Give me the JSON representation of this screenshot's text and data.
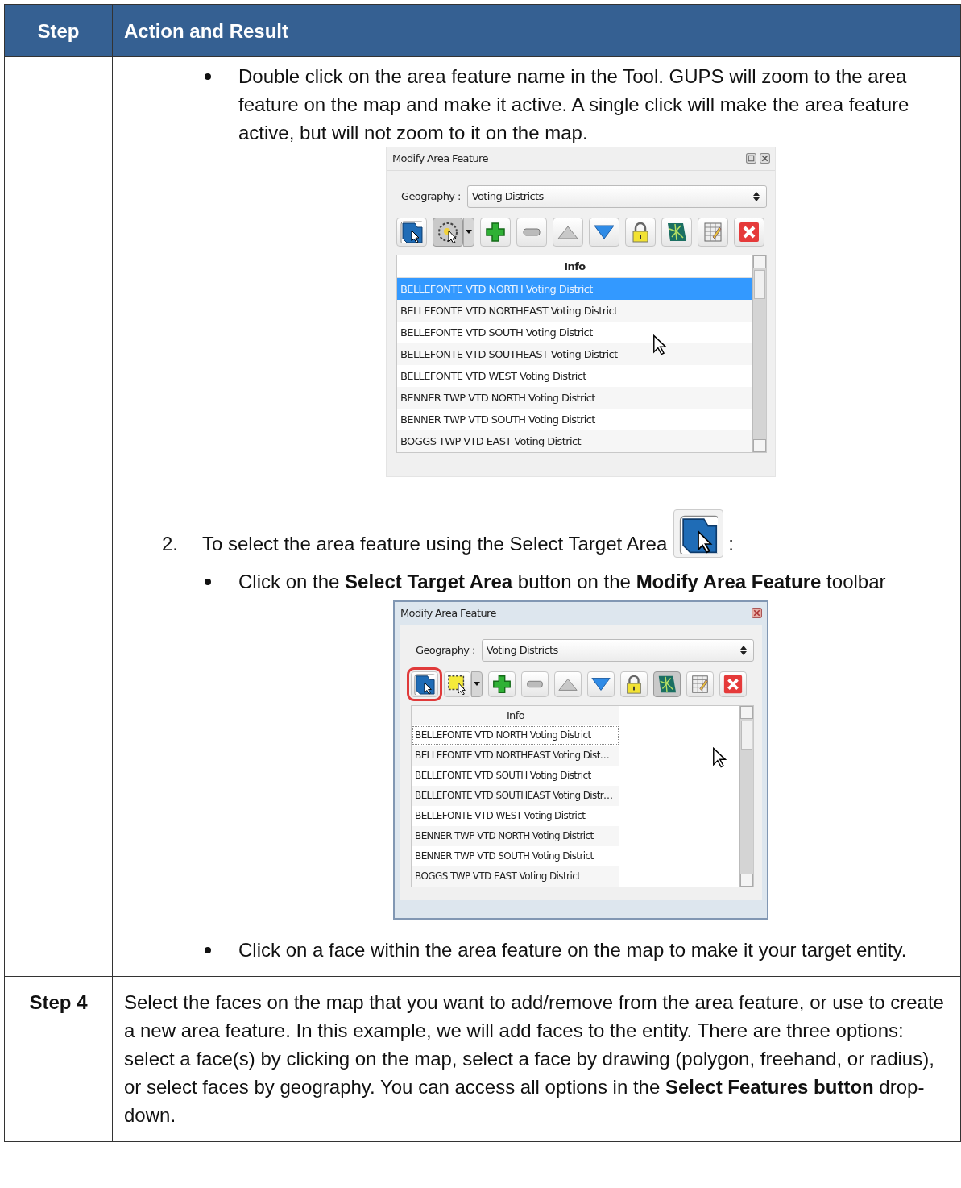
{
  "table": {
    "columns": [
      "Step",
      "Action and Result"
    ],
    "rows": [
      {
        "blocks": [
          {
            "kind": "bullet",
            "text": "Double click on the area feature name in the Tool. GUPS will zoom to the area feature on the map and make it active. A single click will make the area feature active, but will not zoom to it on the map."
          },
          {
            "kind": "dialog",
            "floating": false,
            "title": "Modify Area Feature",
            "geography_label": "Geography :",
            "geography": "Voting Districts",
            "list_header": "Info",
            "stretch_column": true,
            "tools": [
              {
                "kind": "select-target",
                "pressed": false,
                "highlighted": false,
                "dropdown": false
              },
              {
                "kind": "select-circle",
                "pressed": true,
                "highlighted": false,
                "dropdown": true
              },
              {
                "kind": "add",
                "pressed": false,
                "highlighted": false,
                "dropdown": false
              },
              {
                "kind": "remove",
                "pressed": false,
                "highlighted": false,
                "dropdown": false
              },
              {
                "kind": "up",
                "pressed": false,
                "highlighted": false,
                "dropdown": false
              },
              {
                "kind": "down",
                "pressed": false,
                "highlighted": false,
                "dropdown": false
              },
              {
                "kind": "lock",
                "pressed": false,
                "highlighted": false,
                "dropdown": false
              },
              {
                "kind": "map",
                "pressed": false,
                "highlighted": false,
                "dropdown": false
              },
              {
                "kind": "table",
                "pressed": false,
                "highlighted": false,
                "dropdown": false
              },
              {
                "kind": "delete",
                "pressed": false,
                "highlighted": false,
                "dropdown": false
              }
            ],
            "items": [
              {
                "text": "BELLEFONTE VTD NORTH Voting District",
                "selected": true,
                "focused": false
              },
              {
                "text": "BELLEFONTE VTD NORTHEAST Voting District",
                "selected": false,
                "focused": false
              },
              {
                "text": "BELLEFONTE VTD SOUTH Voting District",
                "selected": false,
                "focused": false
              },
              {
                "text": "BELLEFONTE VTD SOUTHEAST Voting District",
                "selected": false,
                "focused": false
              },
              {
                "text": "BELLEFONTE VTD WEST Voting District",
                "selected": false,
                "focused": false
              },
              {
                "text": "BENNER TWP VTD NORTH Voting District",
                "selected": false,
                "focused": false
              },
              {
                "text": "BENNER TWP VTD SOUTH Voting District",
                "selected": false,
                "focused": false
              },
              {
                "text": "BOGGS TWP VTD EAST Voting District",
                "selected": false,
                "focused": false
              }
            ]
          },
          {
            "kind": "numbered",
            "number": "2.",
            "text": "To select the area feature using the Select Target Area",
            "suffix": ":"
          },
          {
            "kind": "bullet",
            "text": "Click on the **Select Target Area** button on the **Modify Area Feature** toolbar"
          },
          {
            "kind": "dialog",
            "floating": true,
            "title": "Modify Area Feature",
            "geography_label": "Geography :",
            "geography": "Voting Districts",
            "list_header": "Info",
            "stretch_column": false,
            "tools": [
              {
                "kind": "select-target",
                "pressed": false,
                "highlighted": true,
                "dropdown": false
              },
              {
                "kind": "select-rectangle",
                "pressed": false,
                "highlighted": false,
                "dropdown": true
              },
              {
                "kind": "add",
                "pressed": false,
                "highlighted": false,
                "dropdown": false
              },
              {
                "kind": "remove",
                "pressed": false,
                "highlighted": false,
                "dropdown": false
              },
              {
                "kind": "up",
                "pressed": false,
                "highlighted": false,
                "dropdown": false
              },
              {
                "kind": "down",
                "pressed": false,
                "highlighted": false,
                "dropdown": false
              },
              {
                "kind": "lock",
                "pressed": false,
                "highlighted": false,
                "dropdown": false
              },
              {
                "kind": "map",
                "pressed": true,
                "highlighted": false,
                "dropdown": false
              },
              {
                "kind": "table",
                "pressed": false,
                "highlighted": false,
                "dropdown": false
              },
              {
                "kind": "delete",
                "pressed": false,
                "highlighted": false,
                "dropdown": false
              }
            ],
            "items": [
              {
                "text": "BELLEFONTE VTD NORTH Voting District",
                "selected": false,
                "focused": true
              },
              {
                "text": "BELLEFONTE VTD NORTHEAST Voting Dist…",
                "selected": false,
                "focused": false
              },
              {
                "text": "BELLEFONTE VTD SOUTH Voting District",
                "selected": false,
                "focused": false
              },
              {
                "text": "BELLEFONTE VTD SOUTHEAST Voting Distr…",
                "selected": false,
                "focused": false
              },
              {
                "text": "BELLEFONTE VTD WEST Voting District",
                "selected": false,
                "focused": false
              },
              {
                "text": "BENNER TWP VTD NORTH Voting District",
                "selected": false,
                "focused": false
              },
              {
                "text": "BENNER TWP VTD SOUTH Voting District",
                "selected": false,
                "focused": false
              },
              {
                "text": "BOGGS TWP VTD EAST Voting District",
                "selected": false,
                "focused": false
              }
            ]
          },
          {
            "kind": "bullet",
            "text": "Click on a face within the area feature on the map to make it your target entity."
          }
        ]
      },
      {
        "step": "Step 4",
        "blocks": [
          {
            "kind": "paragraph",
            "text": "Select the faces on the map that you want to add/remove from the area feature, or use to create a new area feature. In this example, we will add faces to the entity. There are three options: select a face(s) by clicking on the map, select a face by drawing (polygon, freehand, or radius), or select faces by geography. You can access all options in the **Select Features button** drop-down."
          }
        ]
      }
    ]
  }
}
